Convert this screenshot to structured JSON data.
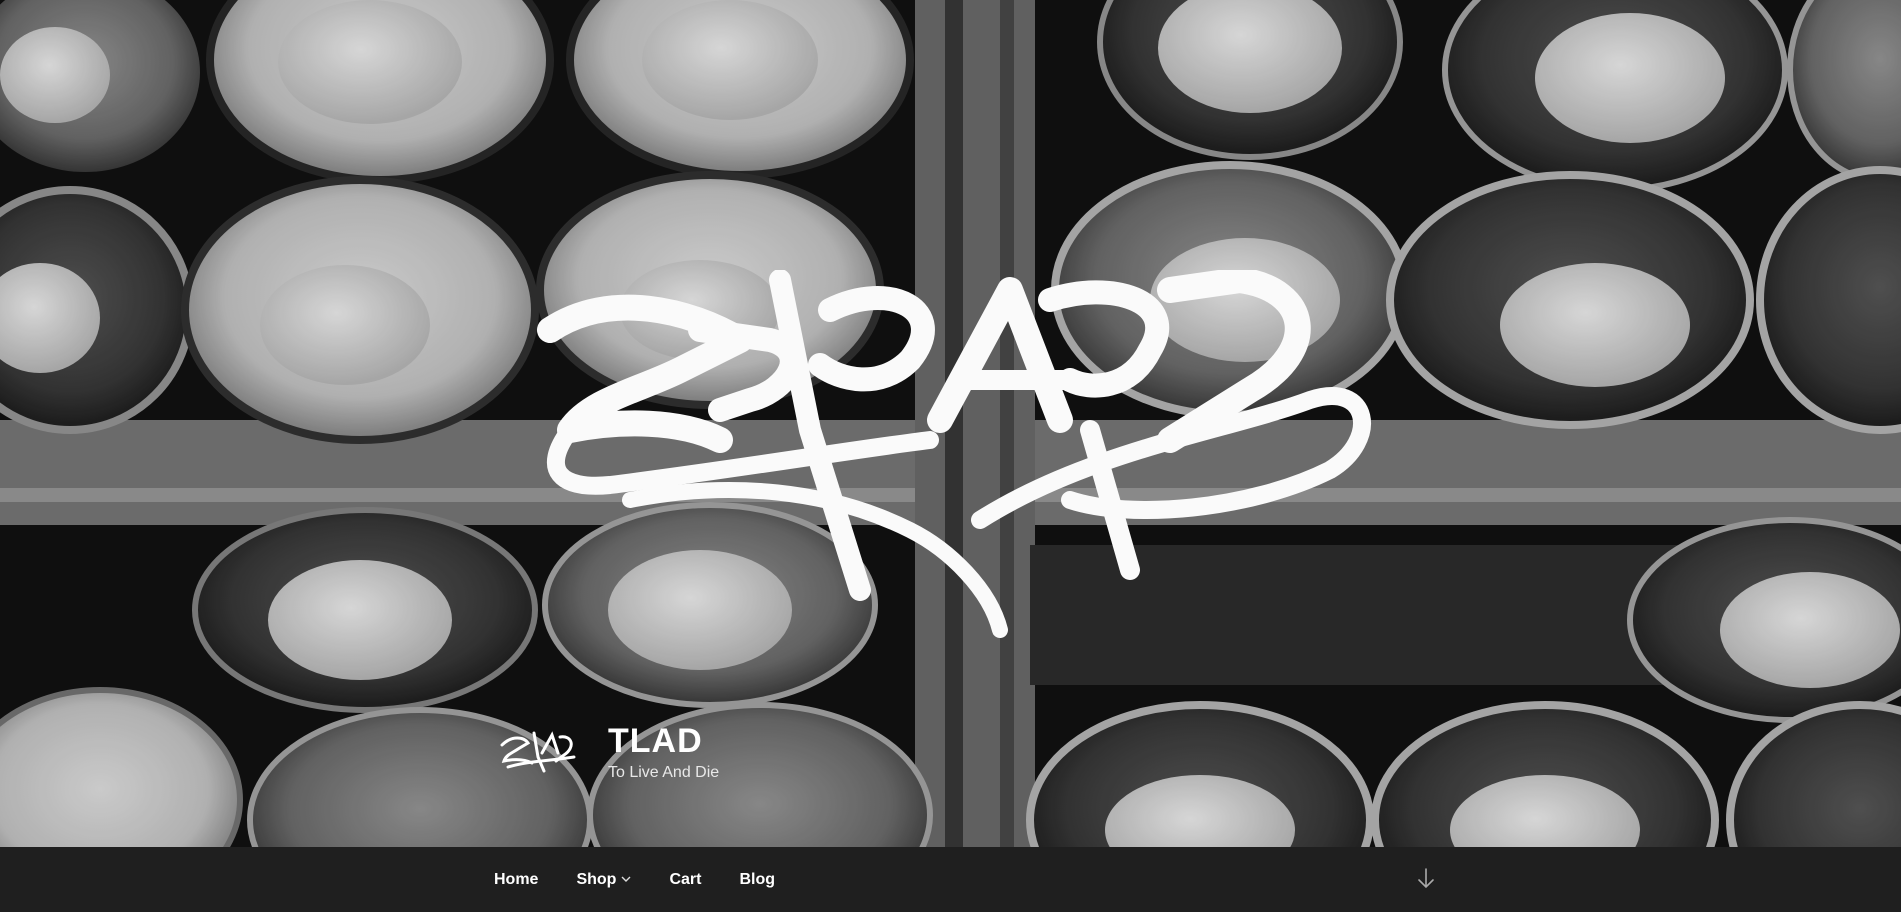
{
  "site": {
    "title": "TLAD",
    "description": "To Live And Die"
  },
  "hero": {
    "image_subject": "grayscale photo of spray paint cans stacked in cardboard boxes",
    "logo_name": "graffiti-tag-logo"
  },
  "nav": {
    "items": [
      {
        "label": "Home"
      },
      {
        "label": "Shop",
        "has_dropdown": true
      },
      {
        "label": "Cart"
      },
      {
        "label": "Blog"
      }
    ]
  },
  "icons": {
    "dropdown": "chevron-down-icon",
    "scroll": "arrow-down-icon"
  },
  "colors": {
    "navbar_bg": "#1f1f1f",
    "text": "#ffffff"
  }
}
